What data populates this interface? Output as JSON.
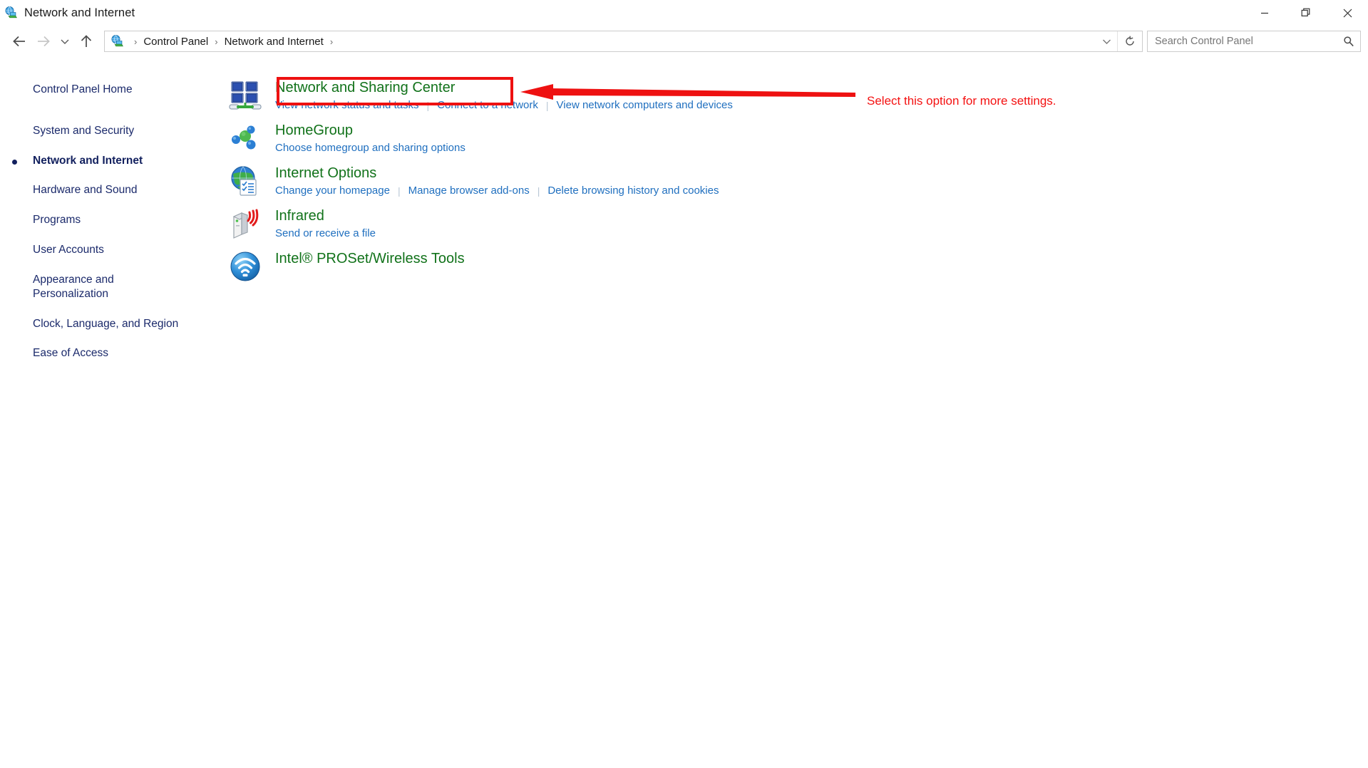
{
  "window": {
    "title": "Network and Internet",
    "icon": "network-globe-icon",
    "controls": {
      "minimize": "minimize-button",
      "maximize": "maximize-restore-button",
      "close": "close-button"
    }
  },
  "navbar": {
    "back": "back-button",
    "forward": "forward-button",
    "recent": "recent-locations-dropdown",
    "up": "up-one-level-button",
    "address_icon": "network-globe-icon",
    "breadcrumbs": [
      {
        "label": "Control Panel"
      },
      {
        "label": "Network and Internet"
      }
    ],
    "separator": "›",
    "chevron": "address-dropdown-chevron",
    "refresh": "refresh-button"
  },
  "search": {
    "placeholder": "Search Control Panel",
    "value": "",
    "icon": "search-icon"
  },
  "sidebar": {
    "items": [
      {
        "label": "Control Panel Home",
        "active": false
      },
      {
        "label": "System and Security",
        "active": false
      },
      {
        "label": "Network and Internet",
        "active": true
      },
      {
        "label": "Hardware and Sound",
        "active": false
      },
      {
        "label": "Programs",
        "active": false
      },
      {
        "label": "User Accounts",
        "active": false
      },
      {
        "label": "Appearance and Personalization",
        "active": false
      },
      {
        "label": "Clock, Language, and Region",
        "active": false
      },
      {
        "label": "Ease of Access",
        "active": false
      }
    ]
  },
  "main": {
    "categories": [
      {
        "title": "Network and Sharing Center",
        "icon": "network-monitors-icon",
        "links": [
          "View network status and tasks",
          "Connect to a network",
          "View network computers and devices"
        ]
      },
      {
        "title": "HomeGroup",
        "icon": "homegroup-nodes-icon",
        "links": [
          "Choose homegroup and sharing options"
        ]
      },
      {
        "title": "Internet Options",
        "icon": "internet-globe-checklist-icon",
        "links": [
          "Change your homepage",
          "Manage browser add-ons",
          "Delete browsing history and cookies"
        ]
      },
      {
        "title": "Infrared",
        "icon": "infrared-device-icon",
        "links": [
          "Send or receive a file"
        ]
      },
      {
        "title": "Intel® PROSet/Wireless Tools",
        "icon": "intel-wireless-icon",
        "links": []
      }
    ]
  },
  "annotations": {
    "callout_text": "Select this option for more settings.",
    "highlight_target": "Network and Sharing Center",
    "color": "#ee1111",
    "arrow": "left-pointing-arrow"
  },
  "colors": {
    "heading_green": "#11721a",
    "link_blue": "#1f6fbf",
    "sidebar_navy": "#1b2a6b",
    "annotation_red": "#ee1111"
  }
}
